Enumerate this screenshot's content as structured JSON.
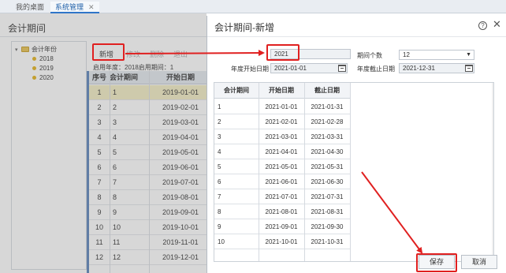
{
  "tabs": {
    "desktop": "我的桌面",
    "system": "系统管理",
    "close_symbol": "✕"
  },
  "page": {
    "title": "会计期间"
  },
  "tree": {
    "root": "会计年份",
    "years": [
      "2018",
      "2019",
      "2020"
    ]
  },
  "toolbar": {
    "new": "新增",
    "edit": "修改",
    "delete": "删除",
    "exit": "退出"
  },
  "info_line": "启用年度：2018启用期间：1",
  "grid": {
    "headers": [
      "序号",
      "会计期间",
      "开始日期"
    ],
    "rows": [
      {
        "no": "1",
        "period": "1",
        "start": "2019-01-01"
      },
      {
        "no": "2",
        "period": "2",
        "start": "2019-02-01"
      },
      {
        "no": "3",
        "period": "3",
        "start": "2019-03-01"
      },
      {
        "no": "4",
        "period": "4",
        "start": "2019-04-01"
      },
      {
        "no": "5",
        "period": "5",
        "start": "2019-05-01"
      },
      {
        "no": "6",
        "period": "6",
        "start": "2019-06-01"
      },
      {
        "no": "7",
        "period": "7",
        "start": "2019-07-01"
      },
      {
        "no": "8",
        "period": "8",
        "start": "2019-08-01"
      },
      {
        "no": "9",
        "period": "9",
        "start": "2019-09-01"
      },
      {
        "no": "10",
        "period": "10",
        "start": "2019-10-01"
      },
      {
        "no": "11",
        "period": "11",
        "start": "2019-11-01"
      },
      {
        "no": "12",
        "period": "12",
        "start": "2019-12-01"
      }
    ]
  },
  "modal": {
    "title": "会计期间-新增",
    "help_symbol": "?",
    "close_symbol": "✕",
    "year_value": "2021",
    "period_count_label": "期间个数",
    "period_count_value": "12",
    "year_start_label": "年度开始日期",
    "year_start_value": "2021-01-01",
    "year_end_label": "年度截止日期",
    "year_end_value": "2021-12-31",
    "table_headers": [
      "会计期间",
      "开始日期",
      "截止日期"
    ],
    "rows": [
      {
        "period": "1",
        "start": "2021-01-01",
        "end": "2021-01-31"
      },
      {
        "period": "2",
        "start": "2021-02-01",
        "end": "2021-02-28"
      },
      {
        "period": "3",
        "start": "2021-03-01",
        "end": "2021-03-31"
      },
      {
        "period": "4",
        "start": "2021-04-01",
        "end": "2021-04-30"
      },
      {
        "period": "5",
        "start": "2021-05-01",
        "end": "2021-05-31"
      },
      {
        "period": "6",
        "start": "2021-06-01",
        "end": "2021-06-30"
      },
      {
        "period": "7",
        "start": "2021-07-01",
        "end": "2021-07-31"
      },
      {
        "period": "8",
        "start": "2021-08-01",
        "end": "2021-08-31"
      },
      {
        "period": "9",
        "start": "2021-09-01",
        "end": "2021-09-30"
      },
      {
        "period": "10",
        "start": "2021-10-01",
        "end": "2021-10-31"
      },
      {
        "period": "",
        "start": "",
        "end": ""
      }
    ],
    "save": "保存",
    "cancel": "取消"
  },
  "colors": {
    "annotation": "#e02020",
    "accent": "#2f75c8",
    "selected_row": "#f3edc4"
  }
}
